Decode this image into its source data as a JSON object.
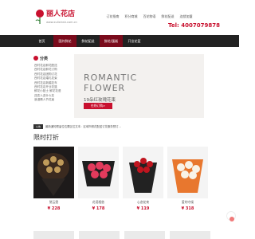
{
  "brand": {
    "title": "丽人花店",
    "subtitle": "www.xulixinsh.com.cn"
  },
  "topnav": [
    "订花指南",
    "积分商城",
    "百花物语",
    "鲜花配送",
    "连锁加盟"
  ],
  "phone": {
    "label": "Tel:",
    "number": "4007079878"
  },
  "mainnav": [
    {
      "label": "首页",
      "active": false
    },
    {
      "label": "国外鲜花",
      "active": true
    },
    {
      "label": "鲜花配送",
      "active": false
    },
    {
      "label": "鲜花/蛋糕",
      "active": false
    },
    {
      "label": "开业花篮",
      "active": false
    }
  ],
  "sidebar": {
    "title": "分类",
    "items": [
      "西村花店鲜花配送",
      "西村花店鲜花订购",
      "西村花店团购订花",
      "西村花店婚礼花束",
      "西村花店新婚花车",
      "西村花店开业花篮",
      "",
      "鲜花小贴士 鲜花花语",
      "送恋人送什么花",
      "浪漫情人节花束"
    ]
  },
  "banner": {
    "line1": "ROMANTIC",
    "line2": "FLOWER",
    "line3": "19朵红玫瑰花束",
    "button": "在线订购>"
  },
  "notice": {
    "tag": "公告",
    "text": "最新通知预留位位置区位文本：区域市鲜花配送订花服务预订..."
  },
  "section_title": "限时打折",
  "products": [
    {
      "name": "黛云霓",
      "price": "¥ 228"
    },
    {
      "name": "花语相依",
      "price": "¥ 178"
    },
    {
      "name": "心恋花束",
      "price": "¥ 119"
    },
    {
      "name": "爱的守候",
      "price": "¥ 318"
    }
  ],
  "colors": {
    "brand_red": "#c8102e",
    "nav_bg": "#222222",
    "nav_active": "#7a0b1c"
  }
}
